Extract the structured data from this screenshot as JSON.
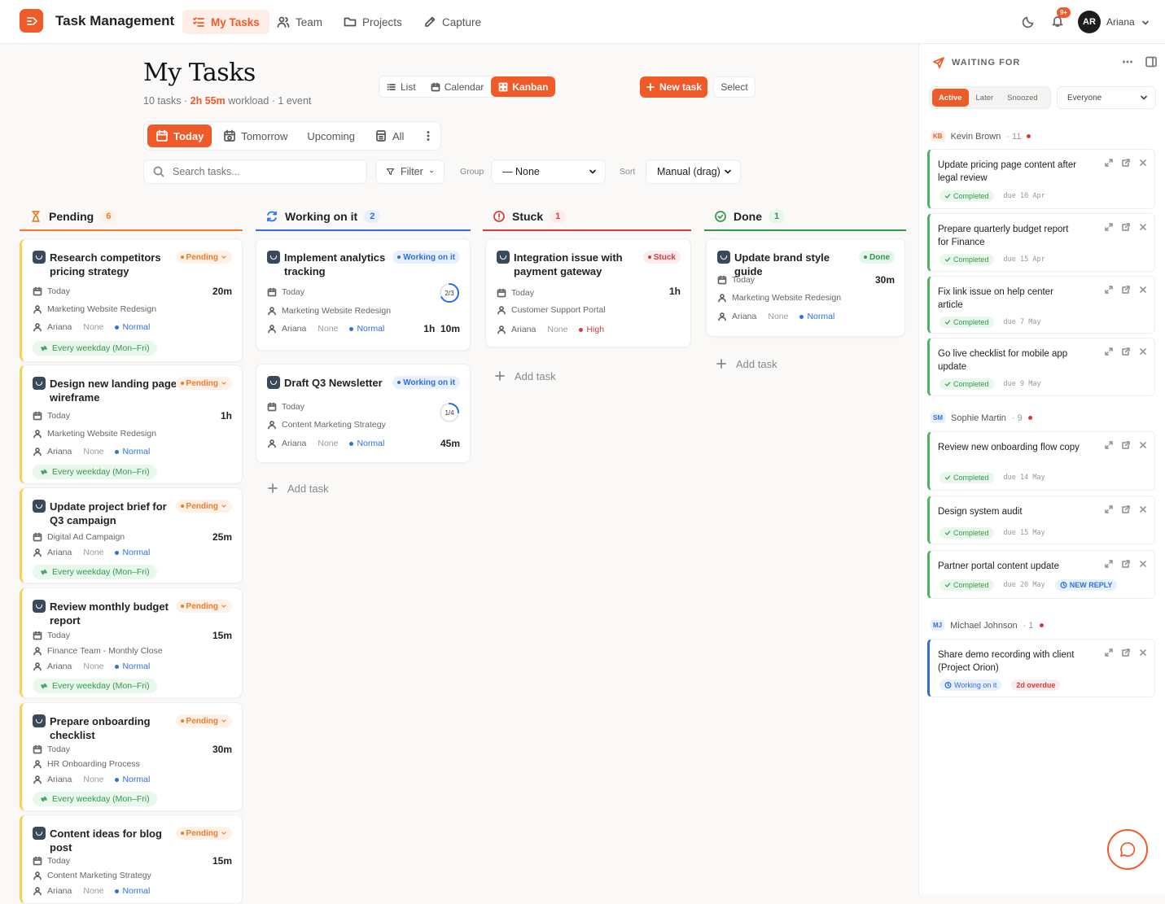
{
  "app": {
    "title": "Task Management"
  },
  "nav": [
    {
      "label": "My Tasks",
      "icon": "list-check-icon",
      "active": true
    },
    {
      "label": "Team",
      "icon": "users-icon"
    },
    {
      "label": "Projects",
      "icon": "folder-icon"
    },
    {
      "label": "Capture",
      "icon": "pen-icon"
    }
  ],
  "user": {
    "initials": "AR",
    "name": "Ariana",
    "notif_badge": "9+"
  },
  "page": {
    "title": "My Tasks",
    "sub_tasks": "10 tasks ·",
    "sub_workload_value": "2h 55m",
    "sub_workload_label": "workload ·",
    "sub_events": "1 event"
  },
  "views": [
    "List",
    "Calendar",
    "Kanban"
  ],
  "active_view": "Kanban",
  "actions": {
    "new_task": "New task",
    "select": "Select"
  },
  "day_filters": [
    "Today",
    "Tomorrow",
    "Upcoming",
    "All"
  ],
  "search": {
    "placeholder": "Search tasks..."
  },
  "filter": {
    "label": "Filter"
  },
  "group": {
    "label": "Group",
    "value": "— None"
  },
  "sort": {
    "label": "Sort",
    "value": "Manual (drag)"
  },
  "columns": [
    {
      "title": "Pending",
      "count": "6",
      "color": "#f07a28"
    },
    {
      "title": "Working on it",
      "count": "2",
      "color": "#2d6fe0"
    },
    {
      "title": "Stuck",
      "count": "1",
      "color": "#d93b3b"
    },
    {
      "title": "Done",
      "count": "1",
      "color": "#2d9b4a"
    }
  ],
  "pending": [
    {
      "title": "Research competitors pricing strategy",
      "status": "Pending",
      "date": "Today",
      "project": "Marketing Website Redesign",
      "assignee": "Ariana",
      "none": "None",
      "priority": "Normal",
      "duration": "20m",
      "recurrence": "Every weekday (Mon–Fri)"
    },
    {
      "title": "Design new landing page wireframe",
      "status": "Pending",
      "date": "Today",
      "project": "Marketing Website Redesign",
      "assignee": "Ariana",
      "none": "None",
      "priority": "Normal",
      "duration": "1h",
      "recurrence": "Every weekday (Mon–Fri)"
    },
    {
      "title": "Update project brief for Q3 campaign",
      "status": "Pending",
      "project": "Digital Ad Campaign",
      "assignee": "Ariana",
      "none": "None",
      "priority": "Normal",
      "duration": "25m",
      "recurrence": "Every weekday (Mon–Fri)"
    },
    {
      "title": "Review monthly budget report",
      "status": "Pending",
      "date": "Today",
      "project": "Finance Team - Monthly Close",
      "assignee": "Ariana",
      "none": "None",
      "priority": "Normal",
      "duration": "15m",
      "recurrence": "Every weekday (Mon–Fri)"
    },
    {
      "title": "Prepare onboarding checklist",
      "status": "Pending",
      "date": "Today",
      "project": "HR Onboarding Process",
      "assignee": "Ariana",
      "none": "None",
      "priority": "Normal",
      "duration": "30m",
      "recurrence": "Every weekday (Mon–Fri)"
    },
    {
      "title": "Content ideas for blog post",
      "status": "Pending",
      "date": "Today",
      "project": "Content Marketing Strategy",
      "assignee": "Ariana",
      "none": "None",
      "priority": "Normal",
      "duration": "15m"
    }
  ],
  "working": [
    {
      "title": "Implement analytics tracking",
      "status": "Working on it",
      "date": "Today",
      "project": "Marketing Website Redesign",
      "assignee": "Ariana",
      "none": "None",
      "priority": "Normal",
      "duration": "1h  10m",
      "progress": "2/3",
      "progress_fraction": 0.667
    },
    {
      "title": "Draft Q3 Newsletter",
      "status": "Working on it",
      "date": "Today",
      "project": "Content Marketing Strategy",
      "assignee": "Ariana",
      "none": "None",
      "priority": "Normal",
      "duration": "45m",
      "progress": "1/4",
      "progress_fraction": 0.25
    }
  ],
  "stuck": [
    {
      "title": "Integration issue with payment gateway",
      "status": "Stuck",
      "date": "Today",
      "project": "Customer Support Portal",
      "assignee": "Ariana",
      "none": "None",
      "priority": "High",
      "duration": "1h"
    }
  ],
  "done": [
    {
      "title": "Update brand style guide",
      "status": "Done",
      "date": "Today",
      "project": "Marketing Website Redesign",
      "assignee": "Ariana",
      "none": "None",
      "priority": "Normal",
      "duration": "30m"
    }
  ],
  "add_task": "Add task",
  "waiting": {
    "title": "WAITING FOR",
    "tabs": [
      "Active",
      "Later",
      "Snoozed"
    ],
    "active_tab": "Active",
    "scope": "Everyone",
    "groups": [
      {
        "initials": "KB",
        "name": "Kevin Brown",
        "count": "· 11",
        "tasks": [
          {
            "title": "Update pricing page content after legal review",
            "status": "Completed",
            "due": "due 10 Apr"
          },
          {
            "title": "Prepare quarterly budget report for Finance",
            "status": "Completed",
            "due": "due 15 Apr"
          },
          {
            "title": "Fix link issue on help center article",
            "status": "Completed",
            "due": "due 7 May"
          },
          {
            "title": "Go live checklist for mobile app update",
            "status": "Completed",
            "due": "due 9 May"
          }
        ]
      },
      {
        "initials": "SM",
        "name": "Sophie Martin",
        "count": "· 9",
        "tasks": [
          {
            "title": "Review new onboarding flow copy",
            "status": "Completed",
            "due": "due 14 May"
          },
          {
            "title": "Design system audit",
            "status": "Completed",
            "due": "due 15 May"
          },
          {
            "title": "Partner portal content update",
            "status": "Completed",
            "due": "due 20 May",
            "tag": "NEW REPLY"
          }
        ]
      },
      {
        "initials": "MJ",
        "name": "Michael Johnson",
        "count": "· 1",
        "tasks": [
          {
            "title": "Share demo recording with client (Project Orion)",
            "status": "Working on it",
            "overdue": "2d overdue"
          }
        ]
      }
    ]
  }
}
